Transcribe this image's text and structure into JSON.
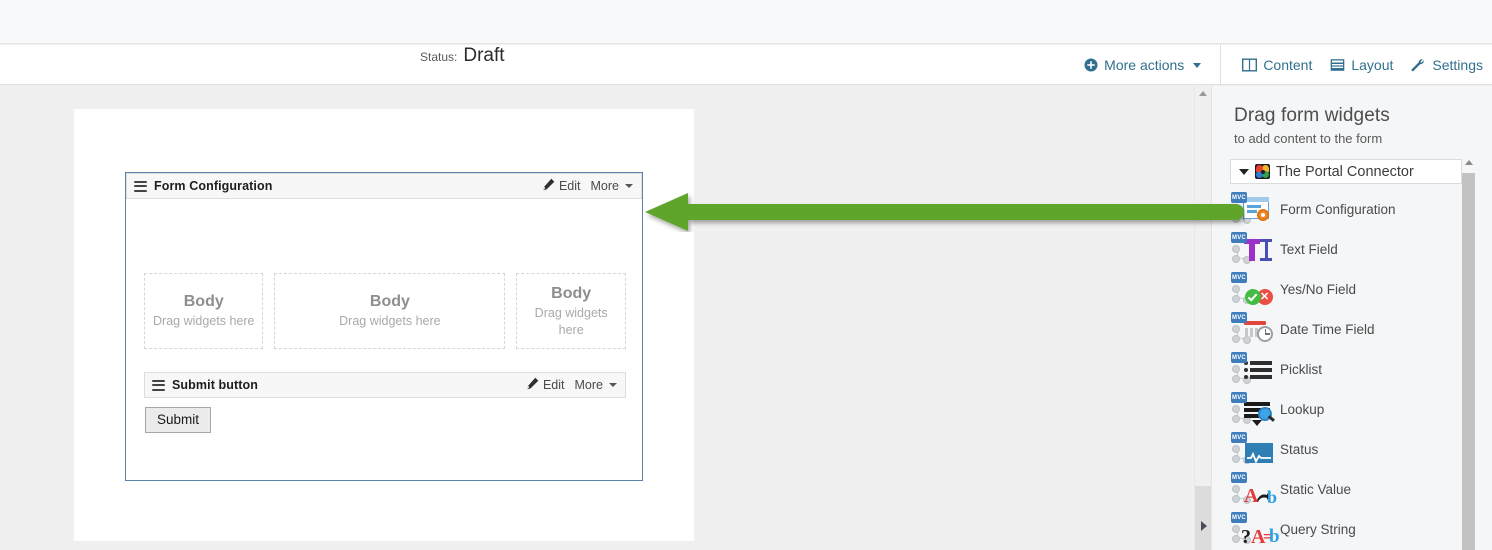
{
  "toolbar": {
    "status_label": "Status:",
    "status_value": "Draft",
    "more_actions": "More actions",
    "tabs": [
      {
        "label": "Content",
        "icon": "content-columns-icon"
      },
      {
        "label": "Layout",
        "icon": "layout-icon"
      },
      {
        "label": "Settings",
        "icon": "wrench-icon"
      }
    ],
    "accent_color": "#31708f"
  },
  "canvas": {
    "form": {
      "header": {
        "title": "Form Configuration",
        "edit_label": "Edit",
        "more_label": "More"
      },
      "dropzones": [
        {
          "title": "Body",
          "subtitle": "Drag widgets here"
        },
        {
          "title": "Body",
          "subtitle": "Drag widgets here"
        },
        {
          "title": "Body",
          "subtitle": "Drag widgets here"
        }
      ],
      "submit_section": {
        "title": "Submit button",
        "edit_label": "Edit",
        "more_label": "More",
        "button_label": "Submit"
      }
    }
  },
  "sidebar": {
    "title": "Drag form widgets",
    "subtitle": "to add content to the form",
    "group": {
      "label": "The Portal Connector",
      "expanded": true
    },
    "widgets": [
      {
        "label": "Form Configuration",
        "icon": "form-configuration-icon"
      },
      {
        "label": "Text Field",
        "icon": "text-field-icon"
      },
      {
        "label": "Yes/No Field",
        "icon": "yes-no-field-icon"
      },
      {
        "label": "Date Time Field",
        "icon": "date-time-field-icon"
      },
      {
        "label": "Picklist",
        "icon": "picklist-icon"
      },
      {
        "label": "Lookup",
        "icon": "lookup-icon"
      },
      {
        "label": "Status",
        "icon": "status-icon"
      },
      {
        "label": "Static Value",
        "icon": "static-value-icon"
      },
      {
        "label": "Query String",
        "icon": "query-string-icon"
      }
    ]
  },
  "annotation": {
    "type": "arrow",
    "direction": "left",
    "color": "#5fa52a"
  }
}
